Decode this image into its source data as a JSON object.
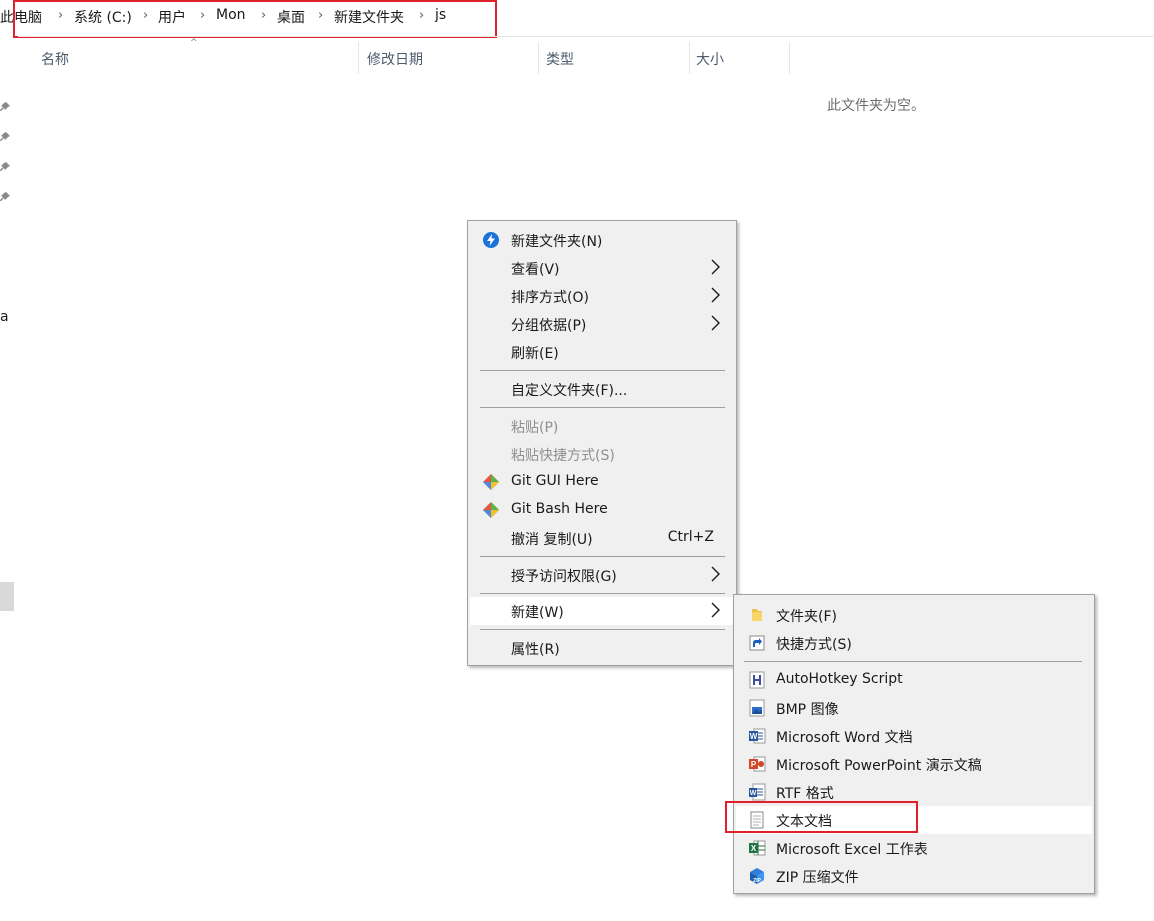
{
  "breadcrumb": {
    "items": [
      "此电脑",
      "系统 (C:)",
      "用户",
      "Mon",
      "桌面",
      "新建文件夹",
      "js"
    ]
  },
  "columns": {
    "name": "名称",
    "modified": "修改日期",
    "type": "类型",
    "size": "大小"
  },
  "empty_message": "此文件夹为空。",
  "nav": {
    "partial_letter": "a"
  },
  "context_menu": {
    "items": [
      {
        "label": "新建文件夹(N)",
        "icon": "new-folder-icon"
      },
      {
        "label": "查看(V)",
        "submenu": true
      },
      {
        "label": "排序方式(O)",
        "submenu": true
      },
      {
        "label": "分组依据(P)",
        "submenu": true
      },
      {
        "label": "刷新(E)"
      },
      {
        "label": "自定义文件夹(F)..."
      },
      {
        "label": "粘贴(P)",
        "disabled": true
      },
      {
        "label": "粘贴快捷方式(S)",
        "disabled": true
      },
      {
        "label": "Git GUI Here",
        "icon": "git-icon"
      },
      {
        "label": "Git Bash Here",
        "icon": "git-icon"
      },
      {
        "label": "撤消 复制(U)",
        "shortcut": "Ctrl+Z"
      },
      {
        "label": "授予访问权限(G)",
        "submenu": true
      },
      {
        "label": "新建(W)",
        "submenu": true,
        "highlighted": true
      },
      {
        "label": "属性(R)"
      }
    ]
  },
  "new_submenu": {
    "items": [
      {
        "label": "文件夹(F)",
        "icon": "folder-icon"
      },
      {
        "label": "快捷方式(S)",
        "icon": "shortcut-icon"
      },
      {
        "label": "AutoHotkey Script",
        "icon": "autohotkey-icon"
      },
      {
        "label": "BMP 图像",
        "icon": "bmp-image-icon"
      },
      {
        "label": "Microsoft Word 文档",
        "icon": "word-icon"
      },
      {
        "label": "Microsoft PowerPoint 演示文稿",
        "icon": "powerpoint-icon"
      },
      {
        "label": "RTF 格式",
        "icon": "rtf-icon"
      },
      {
        "label": "文本文档",
        "icon": "text-document-icon",
        "highlighted": true
      },
      {
        "label": "Microsoft Excel 工作表",
        "icon": "excel-icon"
      },
      {
        "label": "ZIP 压缩文件",
        "icon": "zip-icon"
      }
    ]
  },
  "colors": {
    "annotation_red": "#e0202a",
    "menu_bg": "#f0f0f0",
    "menu_highlight": "#ffffff",
    "header_text": "#4c5b6e"
  }
}
